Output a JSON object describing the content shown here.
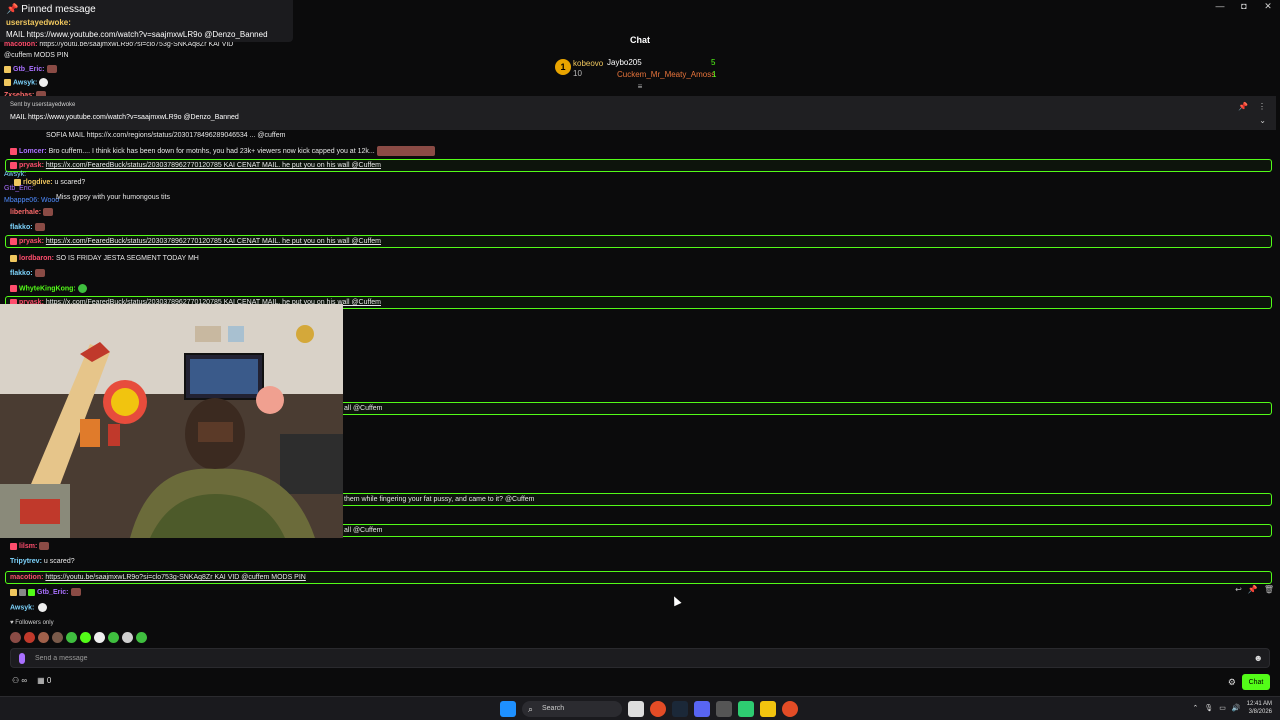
{
  "window": {
    "minimize": "—",
    "maximize": "◘",
    "close": "✕"
  },
  "header": {
    "title": "Chat"
  },
  "leaderboard": {
    "rank": "1",
    "first_name": "kobeovo",
    "first_count": "10",
    "second_name": "Jaybo205",
    "second_count": "5",
    "third_name": "Cuckem_Mr_Meaty_Amoss",
    "third_count": "1"
  },
  "pinned_panel": {
    "title": "Pinned message",
    "user": "userstayedwoke:",
    "text": "MAIL https://www.youtube.com/watch?v=saajmxwLR9o @Denzo_Banned"
  },
  "pin_bar": {
    "sent_by": "Sent by userstayedwoke",
    "message": "MAIL https://www.youtube.com/watch?v=saajmxwLR9o @Denzo_Banned"
  },
  "messages": [
    {
      "user": "macotion:",
      "text": "https://youtu.be/saajmxwLR9o?si=clo753g-SNKAq8Zr KAI VID",
      "color": "#ff4d6d"
    },
    {
      "user": "",
      "text": "@cuffem MODS PIN",
      "color": "#ffffff"
    },
    {
      "user": "Gtb_Eric:",
      "text": "",
      "color": "#a970ff"
    },
    {
      "user": "Awsyk:",
      "text": "",
      "color": "#7dd3fc"
    },
    {
      "user": "Zxsebas:",
      "text": "",
      "color": "#ff6b6b"
    },
    {
      "user": "",
      "text": "SOFIA MAIL https://x.com/regions/status/2030178496289046534 ... @cuffem",
      "color": "#ffffff"
    },
    {
      "user": "Lomcer:",
      "text": "Bro cuffem.... I think kick has been down for motnhs, you had 23k+ viewers now kick capped you at 12k...",
      "color": "#a970ff"
    },
    {
      "user": "pryask:",
      "text": "https://x.com/FearedBuck/status/2030378962770120785 KAI CENAT MAIL. he put you on his wall @Cuffem",
      "color": "#ff4d6d"
    },
    {
      "user": "Awsyk:",
      "text": "",
      "color": "#7dd3fc"
    },
    {
      "user": "rlogdive:",
      "text": "u scared?",
      "color": "#f0c75e"
    },
    {
      "user": "Gtb_Eric:",
      "text": "",
      "color": "#a970ff"
    },
    {
      "user": "Mbappe06:",
      "text": "Wooo",
      "color": "#4f8cff"
    },
    {
      "user": "",
      "text": "Miss gypsy with your humongous tits",
      "color": "#ffffff"
    },
    {
      "user": "liberhale:",
      "text": "",
      "color": "#ff6b6b"
    },
    {
      "user": "flakko:",
      "text": "",
      "color": "#7dd3fc"
    },
    {
      "user": "pryask:",
      "text": "https://x.com/FearedBuck/status/2030378962770120785 KAI CENAT MAIL. he put you on his wall @Cuffem",
      "color": "#ff4d6d"
    },
    {
      "user": "lordbaron:",
      "text": "SO IS FRIDAY JESTA SEGMENT TODAY MH",
      "color": "#ff4d6d"
    },
    {
      "user": "flakko:",
      "text": "",
      "color": "#7dd3fc"
    },
    {
      "user": "WhyteKingKong:",
      "text": "",
      "color": "#53fc18"
    },
    {
      "user": "pryask:",
      "text": "https://x.com/FearedBuck/status/2030378962770120785 KAI CENAT MAIL. he put you on his wall @Cuffem",
      "color": "#ff4d6d"
    },
    {
      "user": "",
      "text": "all @Cuffem",
      "color": "#ffffff"
    },
    {
      "user": "",
      "text": "them while fingering your fat pussy, and came to it? @Cuffem",
      "color": "#ffffff"
    },
    {
      "user": "",
      "text": "all @Cuffem",
      "color": "#ffffff"
    },
    {
      "user": "lilsm:",
      "text": "",
      "color": "#ff4d6d"
    },
    {
      "user": "Tripytrev:",
      "text": "u scared?",
      "color": "#7dd3fc"
    },
    {
      "user": "macotion:",
      "text": "https://youtu.be/saajmxwLR9o?si=clo753g-SNKAq8Zr KAI VID @cuffem MODS PIN",
      "color": "#ff4d6d"
    },
    {
      "user": "Gtb_Eric:",
      "text": "",
      "color": "#a970ff"
    },
    {
      "user": "Awsyk:",
      "text": "",
      "color": "#7dd3fc"
    }
  ],
  "followers_only": "Followers only",
  "input": {
    "placeholder": "Send a message"
  },
  "bottom": {
    "viewers": "∞",
    "count": "0",
    "chat_button": "Chat"
  },
  "taskbar": {
    "search": "Search",
    "time": "12:41 AM",
    "date": "3/8/2026"
  },
  "colors": {
    "accent": "#53fc18",
    "background": "#0b0b0c"
  }
}
